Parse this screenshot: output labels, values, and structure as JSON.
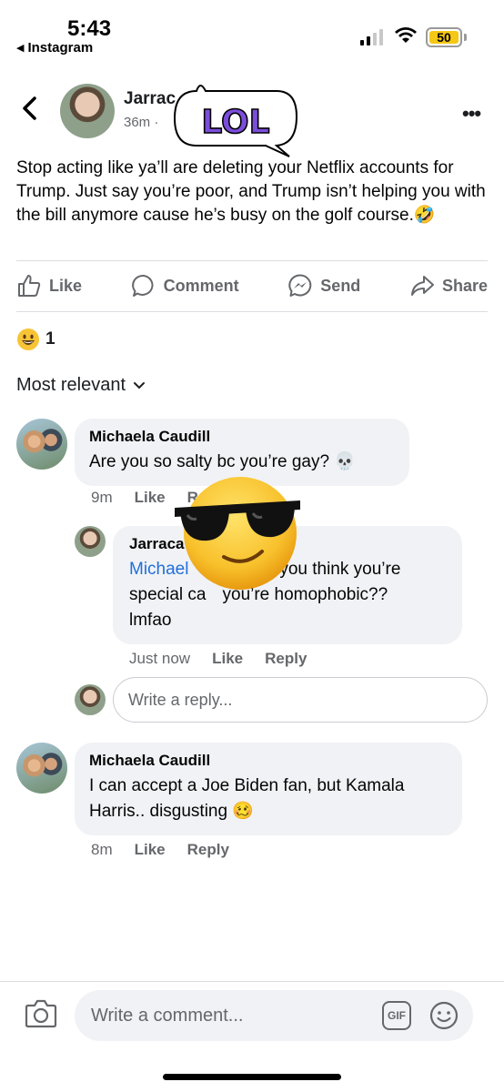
{
  "status_bar": {
    "time": "5:43",
    "back_app": "Instagram",
    "battery": "50",
    "battery_color": "#f4c814"
  },
  "post": {
    "author": "Jarrac",
    "meta": "36m ·",
    "text": "Stop acting like ya’ll are deleting your Netflix accounts for Trump. Just say you’re poor, and Trump isn’t helping you with the bill anymore cause he’s busy on the golf course.",
    "text_emoji": "🤣",
    "sticker_text": "LOL"
  },
  "actions": {
    "like": "Like",
    "comment": "Comment",
    "send": "Send",
    "share": "Share"
  },
  "reactions": {
    "icon": "grinning-face-icon",
    "count": "1"
  },
  "sort": {
    "label": "Most relevant"
  },
  "comments": [
    {
      "name": "Michaela Caudill",
      "text": "Are you so salty bc you’re gay?",
      "emoji": "💀",
      "time": "9m",
      "like": "Like",
      "reply": "R"
    },
    {
      "name": "Michaela Caudill",
      "text": "I can accept a Joe Biden fan, but Kamala Harris.. disgusting",
      "emoji": "🥴",
      "time": "8m",
      "like": "Like",
      "reply": "Reply"
    }
  ],
  "reply": {
    "name": "Jarraca",
    "mention": "Michael",
    "text_line1": "o you think you’re",
    "text_line2_a": "special ca",
    "text_line2_b": "you’re homophobic??",
    "text_line3": "lmfao",
    "time": "Just now",
    "like": "Like",
    "reply": "Reply"
  },
  "reply_input": {
    "placeholder": "Write a reply..."
  },
  "comment_input": {
    "placeholder": "Write a comment...",
    "gif": "GIF"
  },
  "colors": {
    "link": "#216fdb",
    "bubble": "#f0f2f5",
    "secondary_text": "#65676b",
    "sticker_purple": "#7c4ddb"
  }
}
